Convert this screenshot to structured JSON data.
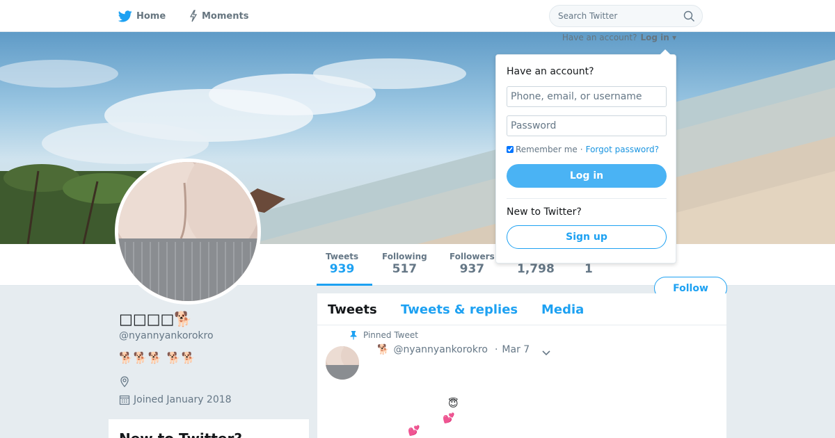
{
  "nav": {
    "home_label": "Home",
    "moments_label": "Moments",
    "search_placeholder": "Search Twitter"
  },
  "account_bar": {
    "prompt": "Have an account?",
    "login_link": "Log in"
  },
  "login_dropdown": {
    "title": "Have an account?",
    "username_placeholder": "Phone, email, or username",
    "password_placeholder": "Password",
    "remember_label": "Remember me",
    "separator": "·",
    "forgot_label": "Forgot password?",
    "login_button": "Log in",
    "new_prompt": "New to Twitter?",
    "signup_button": "Sign up"
  },
  "stats": [
    {
      "label": "Tweets",
      "value": "939"
    },
    {
      "label": "Following",
      "value": "517"
    },
    {
      "label": "Followers",
      "value": "937"
    },
    {
      "label": "",
      "value": "1,798"
    },
    {
      "label": "",
      "value": "1"
    }
  ],
  "follow_button": "Follow",
  "profile": {
    "name": "□□□□🐕",
    "handle": "@nyannyankorokro",
    "bio": "🐕🐕🐕  🐕🐕",
    "joined": "Joined January 2018"
  },
  "signup_module": {
    "title": "New to Twitter?"
  },
  "timeline": {
    "tabs": [
      "Tweets",
      "Tweets & replies",
      "Media"
    ],
    "pinned_label": "Pinned Tweet",
    "tweet": {
      "name": "🐕",
      "handle": "@nyannyankorokro",
      "separator": "·",
      "date": "Mar 7",
      "emojis": [
        "😇",
        "💕",
        "💕"
      ]
    }
  },
  "colors": {
    "accent": "#1da1f2",
    "login_button": "#4ab3f4",
    "page_background": "#e6ecf0",
    "text_secondary": "#657786"
  },
  "icons": {
    "home": "twitter-bird-icon",
    "moments": "lightning-icon",
    "search": "magnifier-icon",
    "pin": "pin-icon",
    "location": "location-pin-icon",
    "calendar": "calendar-icon",
    "caret": "chevron-down-icon"
  }
}
